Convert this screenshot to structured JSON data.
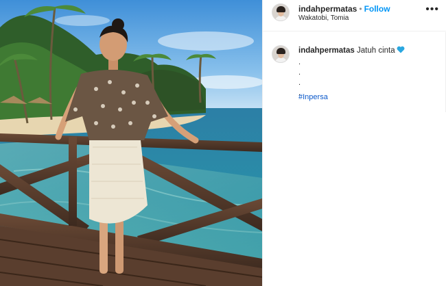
{
  "post": {
    "photo_icon": "beach-dock-photo",
    "username": "indahpermatas",
    "separator": "•",
    "follow_label": "Follow",
    "location": "Wakatobi, Tomia",
    "more_icon": "more-options-icon",
    "more_glyph": "•••"
  },
  "caption": {
    "username": "indahpermatas",
    "text": "Jatuh cinta",
    "emoji": "blue-heart-icon",
    "lines": [
      ".",
      ".",
      ".",
      "."
    ],
    "hashtag": "#Inpersa"
  },
  "colors": {
    "follow_blue": "#0095f6",
    "hashtag_blue": "#0a58ca",
    "heart_blue": "#2aa7e0",
    "border": "#efefef"
  }
}
